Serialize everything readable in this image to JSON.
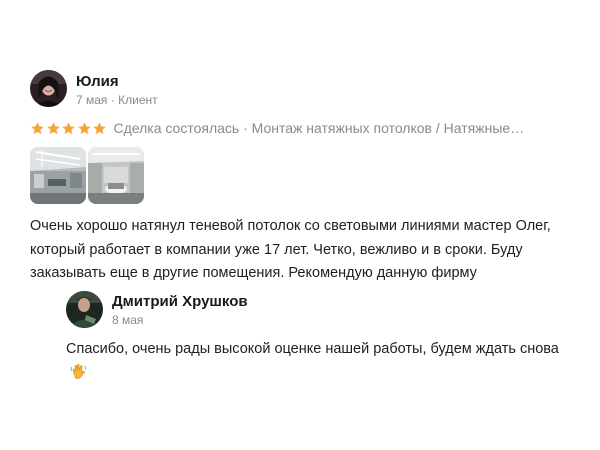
{
  "review": {
    "author": {
      "name": "Юлия",
      "date": "7 мая",
      "separator": "·",
      "role": "Клиент",
      "avatar_icon": "user-avatar-photo"
    },
    "rating": {
      "stars": 5,
      "max": 5,
      "star_color": "#f6a33a",
      "text": "Сделка состоялась · Монтаж натяжных потолков / Натяжные…"
    },
    "photos": [
      {
        "icon": "interior-photo-ceiling-lights"
      },
      {
        "icon": "interior-photo-room"
      }
    ],
    "text": "Очень хорошо натянул теневой потолок со световыми линиями мастер Олег, который работает в компании уже 17 лет. Четко, вежливо и в сроки. Буду заказывать еще в другие помещения. Рекомендую данную фирму"
  },
  "reply": {
    "author": {
      "name": "Дмитрий Хрушков",
      "date": "8 мая",
      "avatar_icon": "user-avatar-photo"
    },
    "text": "Спасибо, очень рады высокой оценке нашей работы, будем ждать снова",
    "emoji": "waving-hand-emoji"
  }
}
